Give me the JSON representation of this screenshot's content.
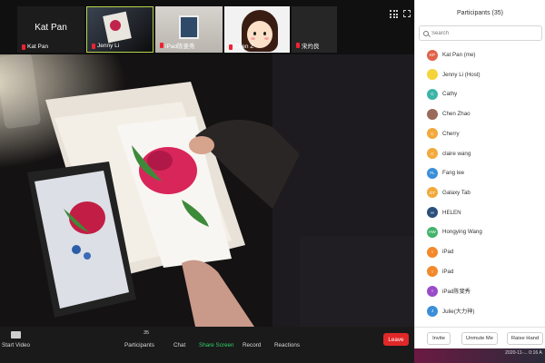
{
  "thumbnails": [
    {
      "name": "Kat Pan",
      "big_name": "Kat Pan"
    },
    {
      "name": "Jenny Li"
    },
    {
      "name": "iPad陈斐秀"
    },
    {
      "name": "Chen Z"
    },
    {
      "name": "宋灼良"
    }
  ],
  "toolbar": {
    "start_video": "Start Video",
    "participants": "Participants",
    "participants_count": "35",
    "chat": "Chat",
    "share_screen": "Share Screen",
    "record": "Record",
    "reactions": "Reactions",
    "leave": "Leave"
  },
  "panel": {
    "title": "Participants (35)",
    "search_placeholder": "Search",
    "participants": [
      {
        "name": "Kat Pan (me)",
        "initials": "KP",
        "color": "#e0634a"
      },
      {
        "name": "Jenny Li (Host)",
        "initials": "",
        "color": "#f4d43a"
      },
      {
        "name": "Cathy",
        "initials": "C",
        "color": "#3cb4a8"
      },
      {
        "name": "Chen Zhao",
        "initials": "",
        "color": "#9a6a58"
      },
      {
        "name": "Cherry",
        "initials": "C",
        "color": "#f2a93b"
      },
      {
        "name": "claire wang",
        "initials": "C",
        "color": "#f2a93b"
      },
      {
        "name": "Fang lee",
        "initials": "FL",
        "color": "#3a8fd8"
      },
      {
        "name": "Galaxy Tab",
        "initials": "GT",
        "color": "#f2a93b"
      },
      {
        "name": "HELEN",
        "initials": "H",
        "color": "#2a4f7a"
      },
      {
        "name": "Hongying Wang",
        "initials": "HW",
        "color": "#42b36b"
      },
      {
        "name": "iPad",
        "initials": "I",
        "color": "#f2892b"
      },
      {
        "name": "iPad",
        "initials": "I",
        "color": "#f2892b"
      },
      {
        "name": "iPad陈斐秀",
        "initials": "I",
        "color": "#9a4cc8"
      },
      {
        "name": "Julie(大力神)",
        "initials": "J",
        "color": "#3a8fd8"
      }
    ],
    "invite": "Invite",
    "unmute_me": "Unmute Me",
    "raise_hand": "Raise Hand"
  },
  "timestamp": "2020-11-... 0:16 A"
}
